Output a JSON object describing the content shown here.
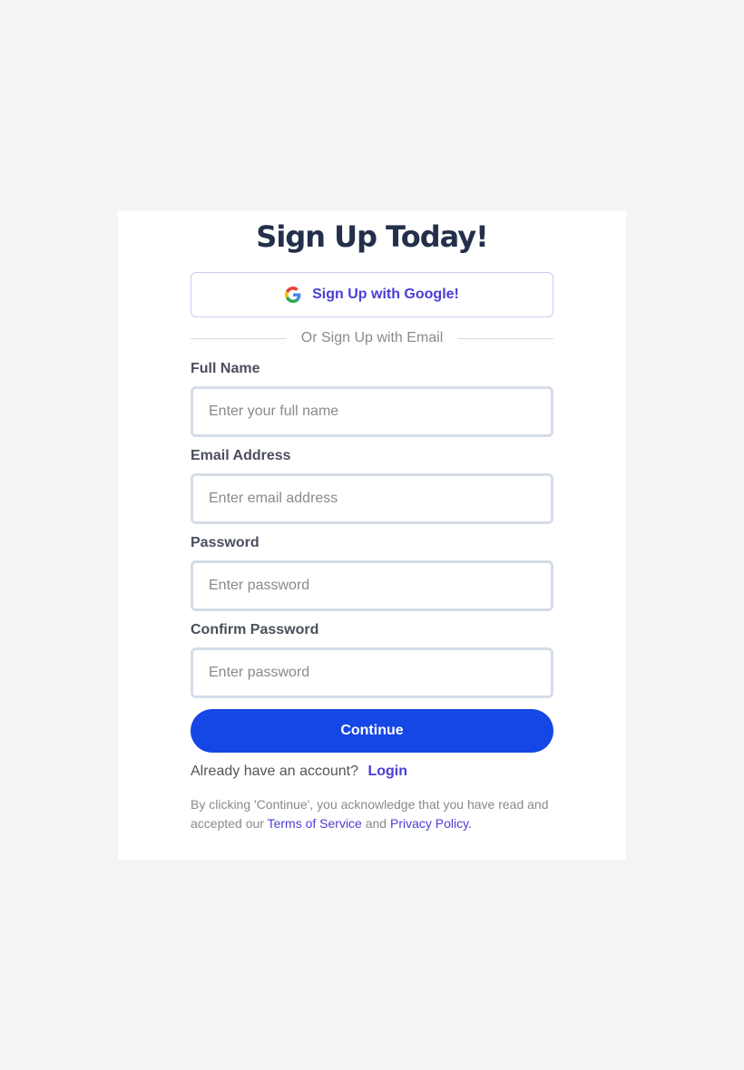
{
  "title": "Sign Up Today!",
  "google_button": {
    "label": "Sign Up with Google!",
    "icon": "google-icon"
  },
  "divider_text": "Or Sign Up with Email",
  "fields": [
    {
      "label": "Full Name",
      "placeholder": "Enter your full name",
      "value": ""
    },
    {
      "label": "Email Address",
      "placeholder": "Enter email address",
      "value": ""
    },
    {
      "label": "Password",
      "placeholder": "Enter password",
      "value": ""
    },
    {
      "label": "Confirm Password",
      "placeholder": "Enter password",
      "value": ""
    }
  ],
  "continue_label": "Continue",
  "account": {
    "text": "Already have an account?",
    "login_label": "Login"
  },
  "terms": {
    "prefix": "By clicking 'Continue', you acknowledge that you have read and accepted our",
    "tos": "Terms of Service",
    "and": "and",
    "privacy": "Privacy Policy",
    "suffix": "."
  },
  "colors": {
    "primary": "#1546e6",
    "accent": "#4a3ed6",
    "title": "#24304a",
    "background": "#f4f4f4"
  }
}
